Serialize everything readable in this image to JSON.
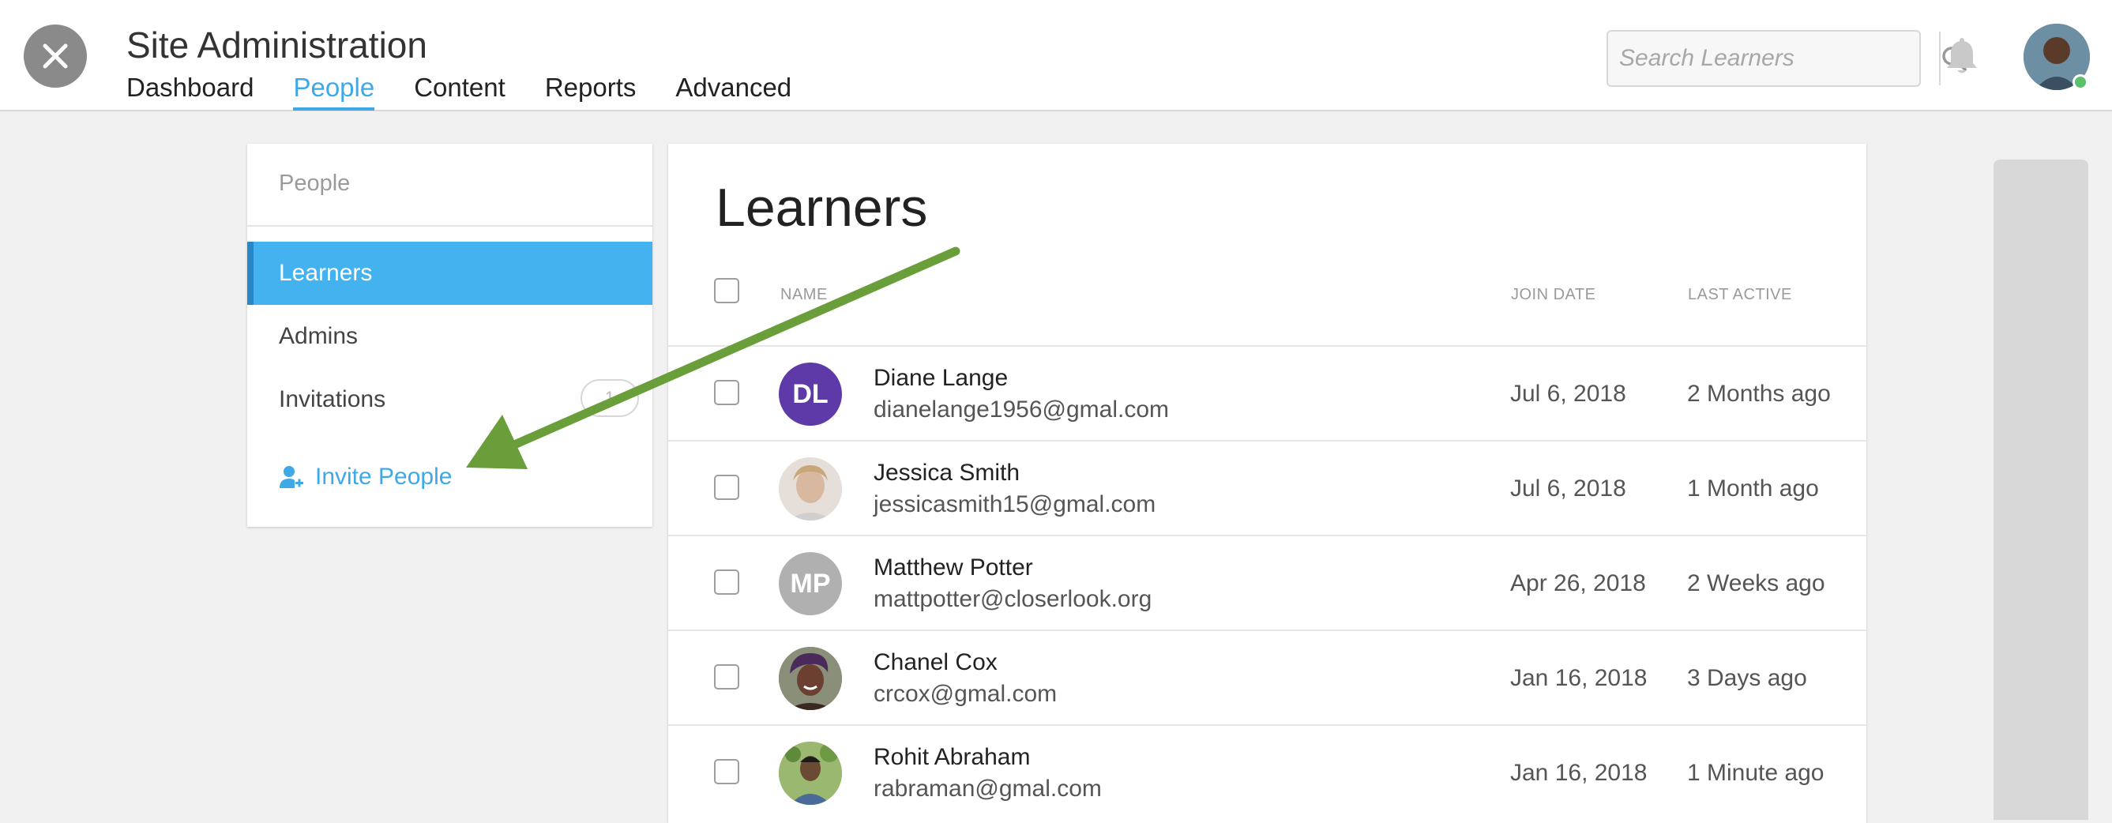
{
  "header": {
    "title": "Site Administration",
    "nav": [
      {
        "label": "Dashboard",
        "active": false
      },
      {
        "label": "People",
        "active": true
      },
      {
        "label": "Content",
        "active": false
      },
      {
        "label": "Reports",
        "active": false
      },
      {
        "label": "Advanced",
        "active": false
      }
    ],
    "search_placeholder": "Search Learners"
  },
  "sidebar": {
    "heading": "People",
    "items": [
      {
        "label": "Learners",
        "active": true
      },
      {
        "label": "Admins",
        "active": false
      },
      {
        "label": "Invitations",
        "active": false
      }
    ],
    "invitations_count": "1",
    "invite_label": "Invite People"
  },
  "main": {
    "title": "Learners",
    "columns": {
      "name": "NAME",
      "join_date": "JOIN DATE",
      "last_active": "LAST ACTIVE"
    },
    "rows": [
      {
        "initials": "DL",
        "avatar_color": "#5e3aa8",
        "name": "Diane Lange",
        "email": "dianelange1956@gmal.com",
        "join_date": "Jul 6, 2018",
        "last_active": "2 Months ago"
      },
      {
        "initials": "",
        "avatar_color": "#d8c8bd",
        "name": "Jessica Smith",
        "email": "jessicasmith15@gmal.com",
        "join_date": "Jul 6, 2018",
        "last_active": "1 Month ago"
      },
      {
        "initials": "MP",
        "avatar_color": "#b0b0b0",
        "name": "Matthew Potter",
        "email": "mattpotter@closerlook.org",
        "join_date": "Apr 26, 2018",
        "last_active": "2 Weeks ago"
      },
      {
        "initials": "",
        "avatar_color": "#6b4a3a",
        "name": "Chanel Cox",
        "email": "crcox@gmal.com",
        "join_date": "Jan 16, 2018",
        "last_active": "3 Days ago"
      },
      {
        "initials": "",
        "avatar_color": "#7a9a5a",
        "name": "Rohit Abraham",
        "email": "rabraman@gmal.com",
        "join_date": "Jan 16, 2018",
        "last_active": "1 Minute ago"
      }
    ]
  },
  "colors": {
    "accent": "#45b2f0",
    "arrow": "#6a9e3a"
  },
  "icons": [
    "close-icon",
    "search-icon",
    "bell-icon",
    "add-user-icon"
  ]
}
